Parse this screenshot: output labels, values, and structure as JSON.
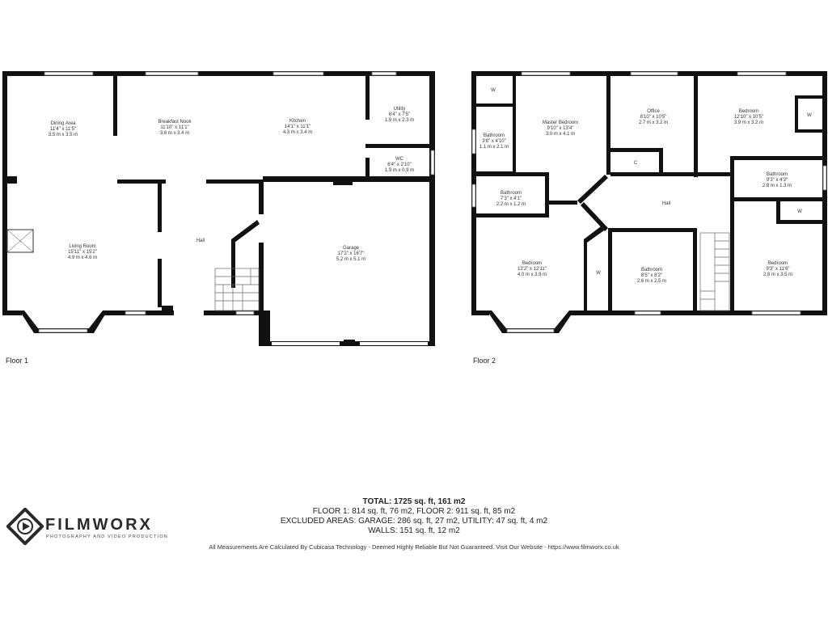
{
  "floors": [
    {
      "label": "Floor 1",
      "rooms": [
        {
          "name": "Dining Area",
          "imperial": "11'4\" x 11'5\"",
          "metric": "3.5 m x 3.5 m"
        },
        {
          "name": "Breakfast Nook",
          "imperial": "11'10\" x 11'1\"",
          "metric": "3.6 m x 3.4 m"
        },
        {
          "name": "Kitchen",
          "imperial": "14'1\" x 11'1\"",
          "metric": "4.3 m x 3.4 m"
        },
        {
          "name": "Utility",
          "imperial": "6'4\" x 7'5\"",
          "metric": "1.9 m x 2.3 m"
        },
        {
          "name": "WC",
          "imperial": "6'4\" x 2'10\"",
          "metric": "1.9 m x 0.9 m"
        },
        {
          "name": "Living Room",
          "imperial": "15'11\" x 15'2\"",
          "metric": "4.9 m x 4.6 m"
        },
        {
          "name": "Hall",
          "imperial": "",
          "metric": ""
        },
        {
          "name": "Garage",
          "imperial": "17'2\" x 16'7\"",
          "metric": "5.2 m x 5.1 m"
        }
      ]
    },
    {
      "label": "Floor 2",
      "rooms": [
        {
          "name": "Master Bedroom",
          "imperial": "9'10\" x 13'4\"",
          "metric": "3.0 m x 4.1 m"
        },
        {
          "name": "Office",
          "imperial": "8'10\" x 10'5\"",
          "metric": "2.7 m x 3.2 m"
        },
        {
          "name": "Bedroom",
          "imperial": "12'10\" x 10'5\"",
          "metric": "3.9 m x 3.2 m"
        },
        {
          "name": "Bathroom",
          "imperial": "3'8\" x 4'10\"",
          "metric": "1.1 m x 2.1 m"
        },
        {
          "name": "Bathroom",
          "imperial": "7'3\" x 4'1\"",
          "metric": "2.2 m x 1.2 m"
        },
        {
          "name": "Bathroom",
          "imperial": "9'3\" x 4'3\"",
          "metric": "2.8 m x 1.3 m"
        },
        {
          "name": "Hall",
          "imperial": "",
          "metric": ""
        },
        {
          "name": "Bedroom",
          "imperial": "13'2\" x 12'11\"",
          "metric": "4.0 m x 3.9 m"
        },
        {
          "name": "Bathroom",
          "imperial": "8'5\" x 8'2\"",
          "metric": "2.6 m x 2.5 m"
        },
        {
          "name": "Bedroom",
          "imperial": "9'3\" x 11'6\"",
          "metric": "2.8 m x 3.5 m"
        }
      ],
      "markers": {
        "wardrobe": "W",
        "closet": "C"
      }
    }
  ],
  "summary": {
    "total": "TOTAL: 1725 sq. ft, 161 m2",
    "floors_line": "FLOOR 1: 814 sq. ft, 76 m2, FLOOR 2: 911 sq. ft, 85 m2",
    "excluded_line": "EXCLUDED AREAS: GARAGE: 286 sq. ft, 27 m2, UTILITY: 47 sq. ft, 4 m2",
    "walls_line": "WALLS: 151 sq. ft, 12 m2"
  },
  "brand": {
    "name": "FILMWORX",
    "tagline": "PHOTOGRAPHY AND VIDEO PRODUCTION"
  },
  "disclaimer": "All Measurements Are Calculated By Cubicasa Technology - Deemed Highly Reliable But Not Guaranteed. Visit Our Website - https://www.filmworx.co.uk",
  "colors": {
    "wall": "#111111",
    "text": "#333333"
  }
}
